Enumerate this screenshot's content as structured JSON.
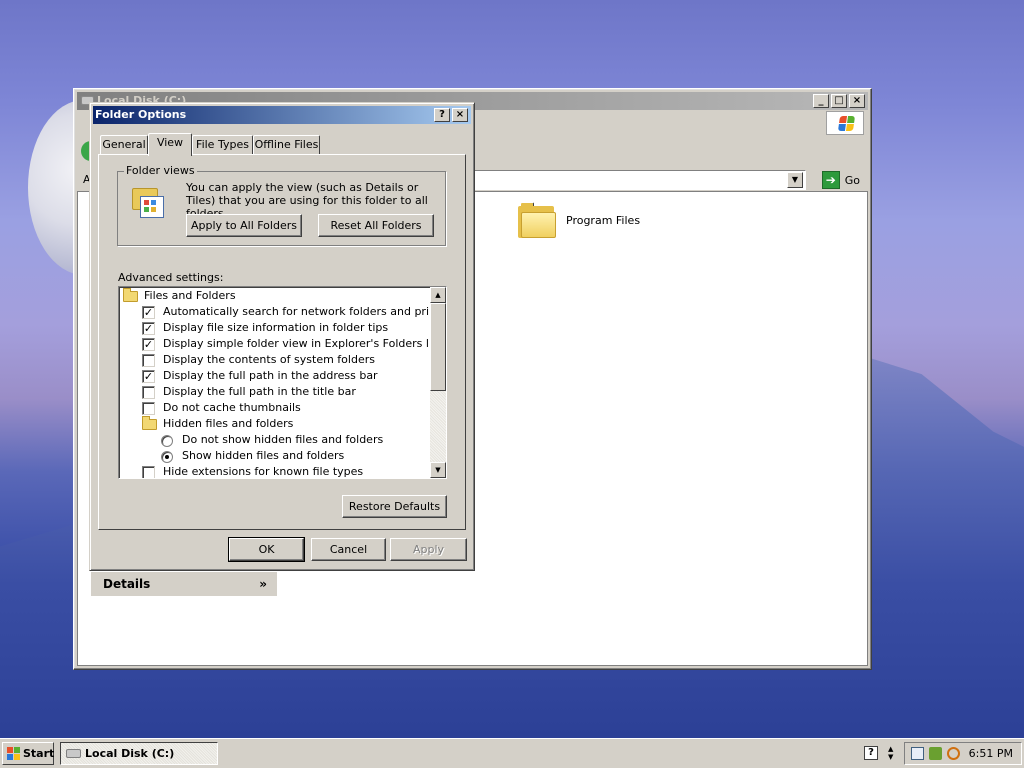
{
  "explorer": {
    "title": "Local Disk (C:)",
    "address_label": "A",
    "go_label": "Go",
    "files": [
      {
        "name": "Program Files",
        "icon": "folder-icon"
      }
    ],
    "details_label": "Details"
  },
  "dialog": {
    "title": "Folder Options",
    "tabs": [
      {
        "label": "General",
        "active": false
      },
      {
        "label": "View",
        "active": true
      },
      {
        "label": "File Types",
        "active": false
      },
      {
        "label": "Offline Files",
        "active": false
      }
    ],
    "folder_views": {
      "legend": "Folder views",
      "description": "You can apply the view (such as Details or Tiles) that you are using for this folder to all folders.",
      "apply_button": "Apply to All Folders",
      "reset_button": "Reset All Folders"
    },
    "advanced_label": "Advanced settings:",
    "advanced_items": [
      {
        "type": "folder",
        "label": "Files and Folders",
        "indent": 0
      },
      {
        "type": "checkbox",
        "label": "Automatically search for network folders and printers",
        "checked": true,
        "indent": 1
      },
      {
        "type": "checkbox",
        "label": "Display file size information in folder tips",
        "checked": true,
        "indent": 1
      },
      {
        "type": "checkbox",
        "label": "Display simple folder view in Explorer's Folders list",
        "checked": true,
        "indent": 1
      },
      {
        "type": "checkbox",
        "label": "Display the contents of system folders",
        "checked": false,
        "indent": 1
      },
      {
        "type": "checkbox",
        "label": "Display the full path in the address bar",
        "checked": true,
        "indent": 1
      },
      {
        "type": "checkbox",
        "label": "Display the full path in the title bar",
        "checked": false,
        "indent": 1
      },
      {
        "type": "checkbox",
        "label": "Do not cache thumbnails",
        "checked": false,
        "indent": 1
      },
      {
        "type": "folder",
        "label": "Hidden files and folders",
        "indent": 1
      },
      {
        "type": "radio",
        "label": "Do not show hidden files and folders",
        "checked": false,
        "indent": 2
      },
      {
        "type": "radio",
        "label": "Show hidden files and folders",
        "checked": true,
        "indent": 2
      },
      {
        "type": "checkbox",
        "label": "Hide extensions for known file types",
        "checked": false,
        "indent": 1
      }
    ],
    "restore_button": "Restore Defaults",
    "ok_button": "OK",
    "cancel_button": "Cancel",
    "apply_button": "Apply",
    "help_button": "?",
    "close_button": "X"
  },
  "taskbar": {
    "start_label": "Start",
    "task_label": "Local Disk (C:)",
    "help_label": "?",
    "clock": "6:51 PM"
  },
  "colors": {
    "active_title": "#0a246a",
    "inactive_title": "#808080",
    "face": "#d4d0c8"
  }
}
